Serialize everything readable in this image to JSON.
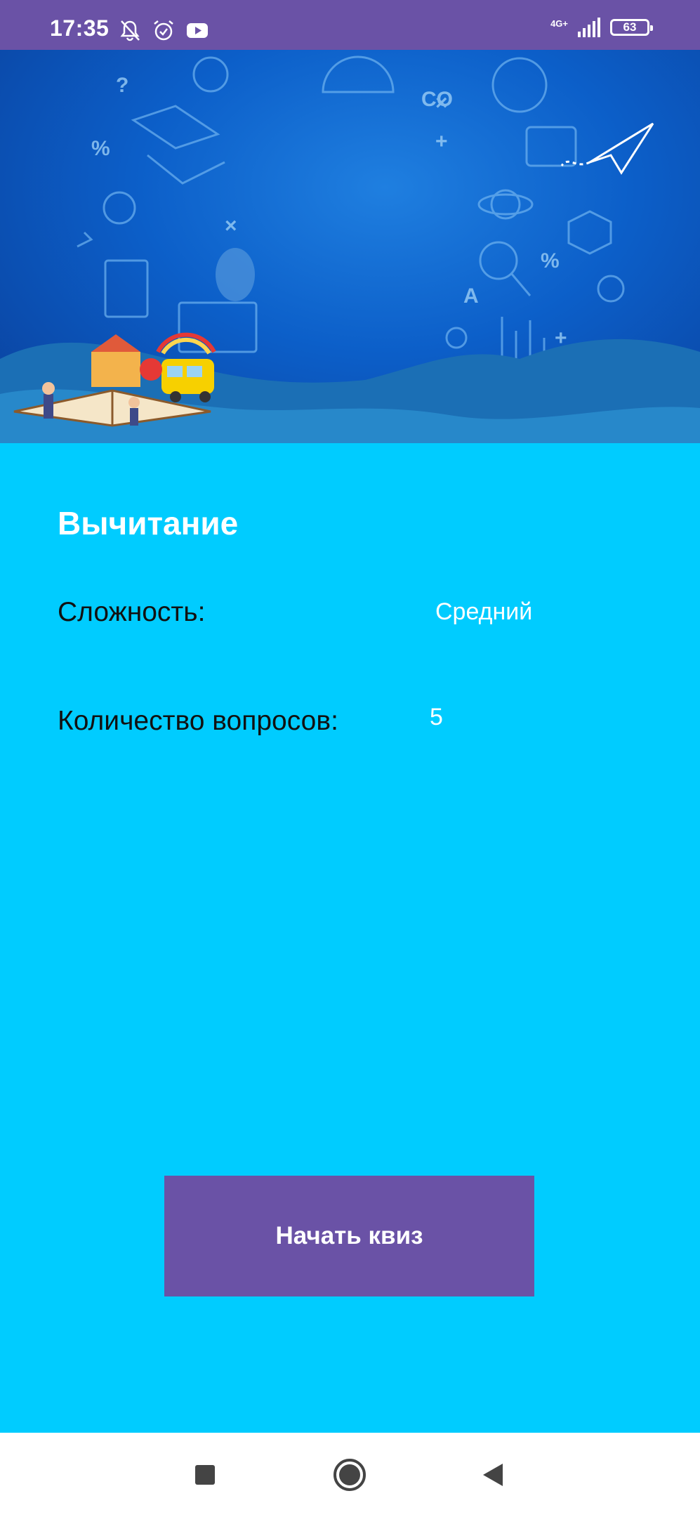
{
  "status_bar": {
    "time": "17:35",
    "network": "4G+",
    "battery": "63",
    "icons": [
      "notifications-off-icon",
      "alarm-icon",
      "youtube-icon",
      "signal-icon",
      "battery-icon"
    ]
  },
  "quiz": {
    "title": "Вычитание",
    "difficulty_label": "Сложность:",
    "difficulty_value": "Средний",
    "questions_label": "Количество вопросов:",
    "questions_value": "5",
    "start_button": "Начать квиз"
  },
  "navigation": {
    "icons": [
      "recents-square-icon",
      "home-circle-icon",
      "back-triangle-icon"
    ]
  },
  "colors": {
    "status_bar": "#6A52A6",
    "background": "#00CCFF",
    "button": "#6A52A6",
    "banner": "#0C5FC9"
  }
}
